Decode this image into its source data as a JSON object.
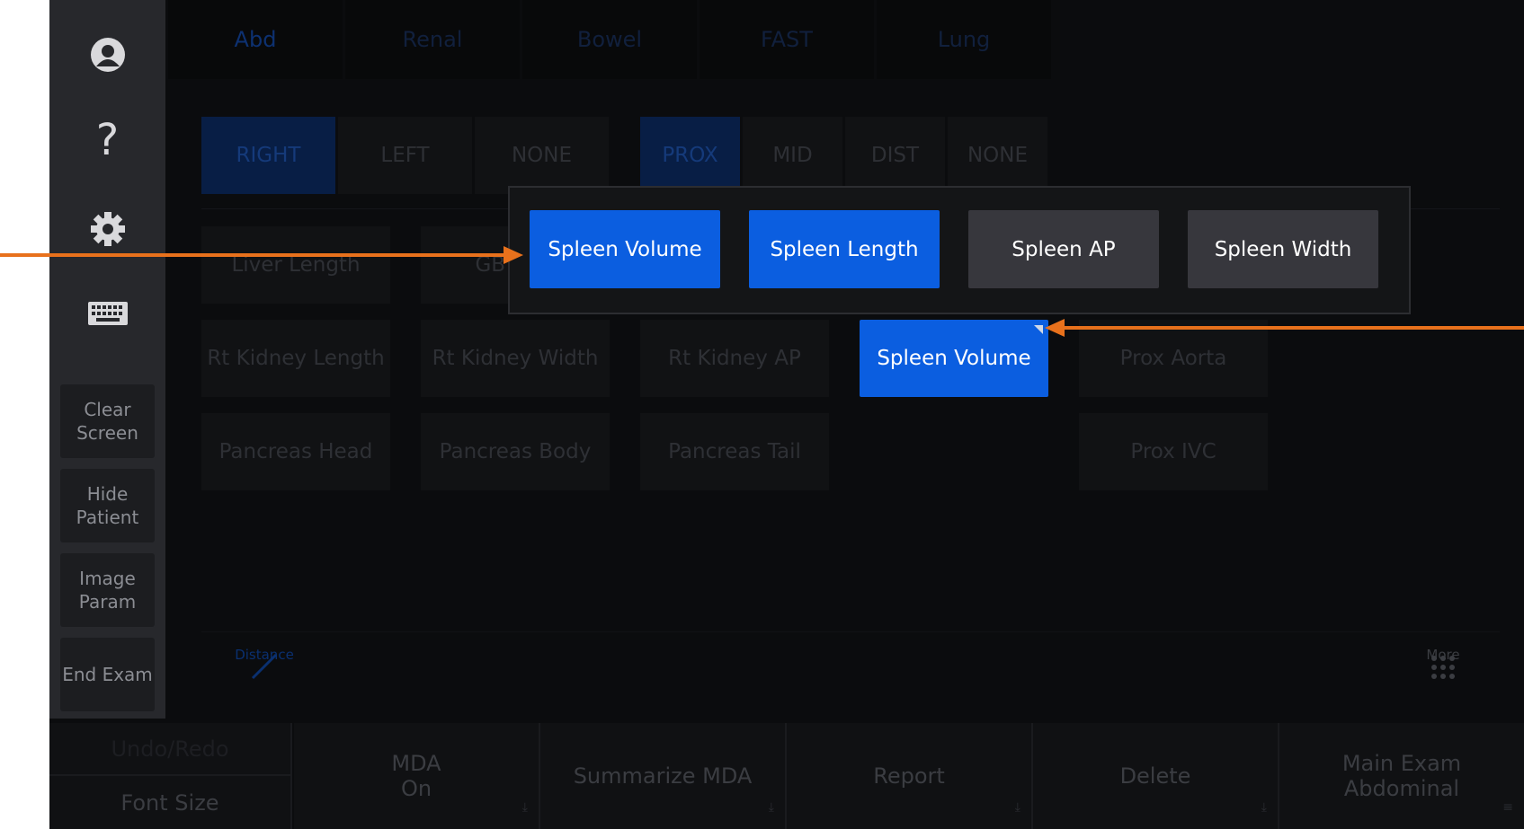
{
  "top_tabs": [
    {
      "label": "Abd",
      "active": true
    },
    {
      "label": "Renal",
      "active": false
    },
    {
      "label": "Bowel",
      "active": false
    },
    {
      "label": "FAST",
      "active": false
    },
    {
      "label": "Lung",
      "active": false
    }
  ],
  "sidebar": {
    "icons": [
      "user-icon",
      "help-icon",
      "settings-gear-icon",
      "keyboard-icon"
    ],
    "help_glyph": "?",
    "buttons": [
      "Clear\nScreen",
      "Hide\nPatient",
      "Image\nParam",
      "End Exam"
    ]
  },
  "side_selector": {
    "options": [
      "RIGHT",
      "LEFT",
      "NONE"
    ],
    "selected": "RIGHT"
  },
  "position_selector": {
    "options": [
      "PROX",
      "MID",
      "DIST",
      "NONE"
    ],
    "selected": "PROX"
  },
  "measurements": {
    "row1": [
      "Liver Length",
      "GB Wall"
    ],
    "row2": [
      "Rt  Kidney Length",
      "Rt  Kidney Width",
      "Rt  Kidney AP",
      "Spleen Volume",
      "Prox Aorta"
    ],
    "row3": [
      "Pancreas Head",
      "Pancreas Body",
      "Pancreas Tail",
      "Prox IVC"
    ]
  },
  "popup": {
    "options": [
      {
        "label": "Spleen Volume",
        "selected": true
      },
      {
        "label": "Spleen Length",
        "selected": true
      },
      {
        "label": "Spleen AP",
        "selected": false
      },
      {
        "label": "Spleen Width",
        "selected": false
      }
    ]
  },
  "toolbar": {
    "first_tool": "Distance",
    "more_label": "More"
  },
  "bottom_bar": {
    "undo_redo": "Undo/Redo",
    "font_size": "Font Size",
    "mda": "MDA\nOn",
    "summarize": "Summarize MDA",
    "report": "Report",
    "delete": "Delete",
    "main_exam": "Main Exam\nAbdominal"
  },
  "colors": {
    "accent_blue": "#0b5ee0",
    "annotation_orange": "#e8711c",
    "background": "#0b0c0e"
  }
}
